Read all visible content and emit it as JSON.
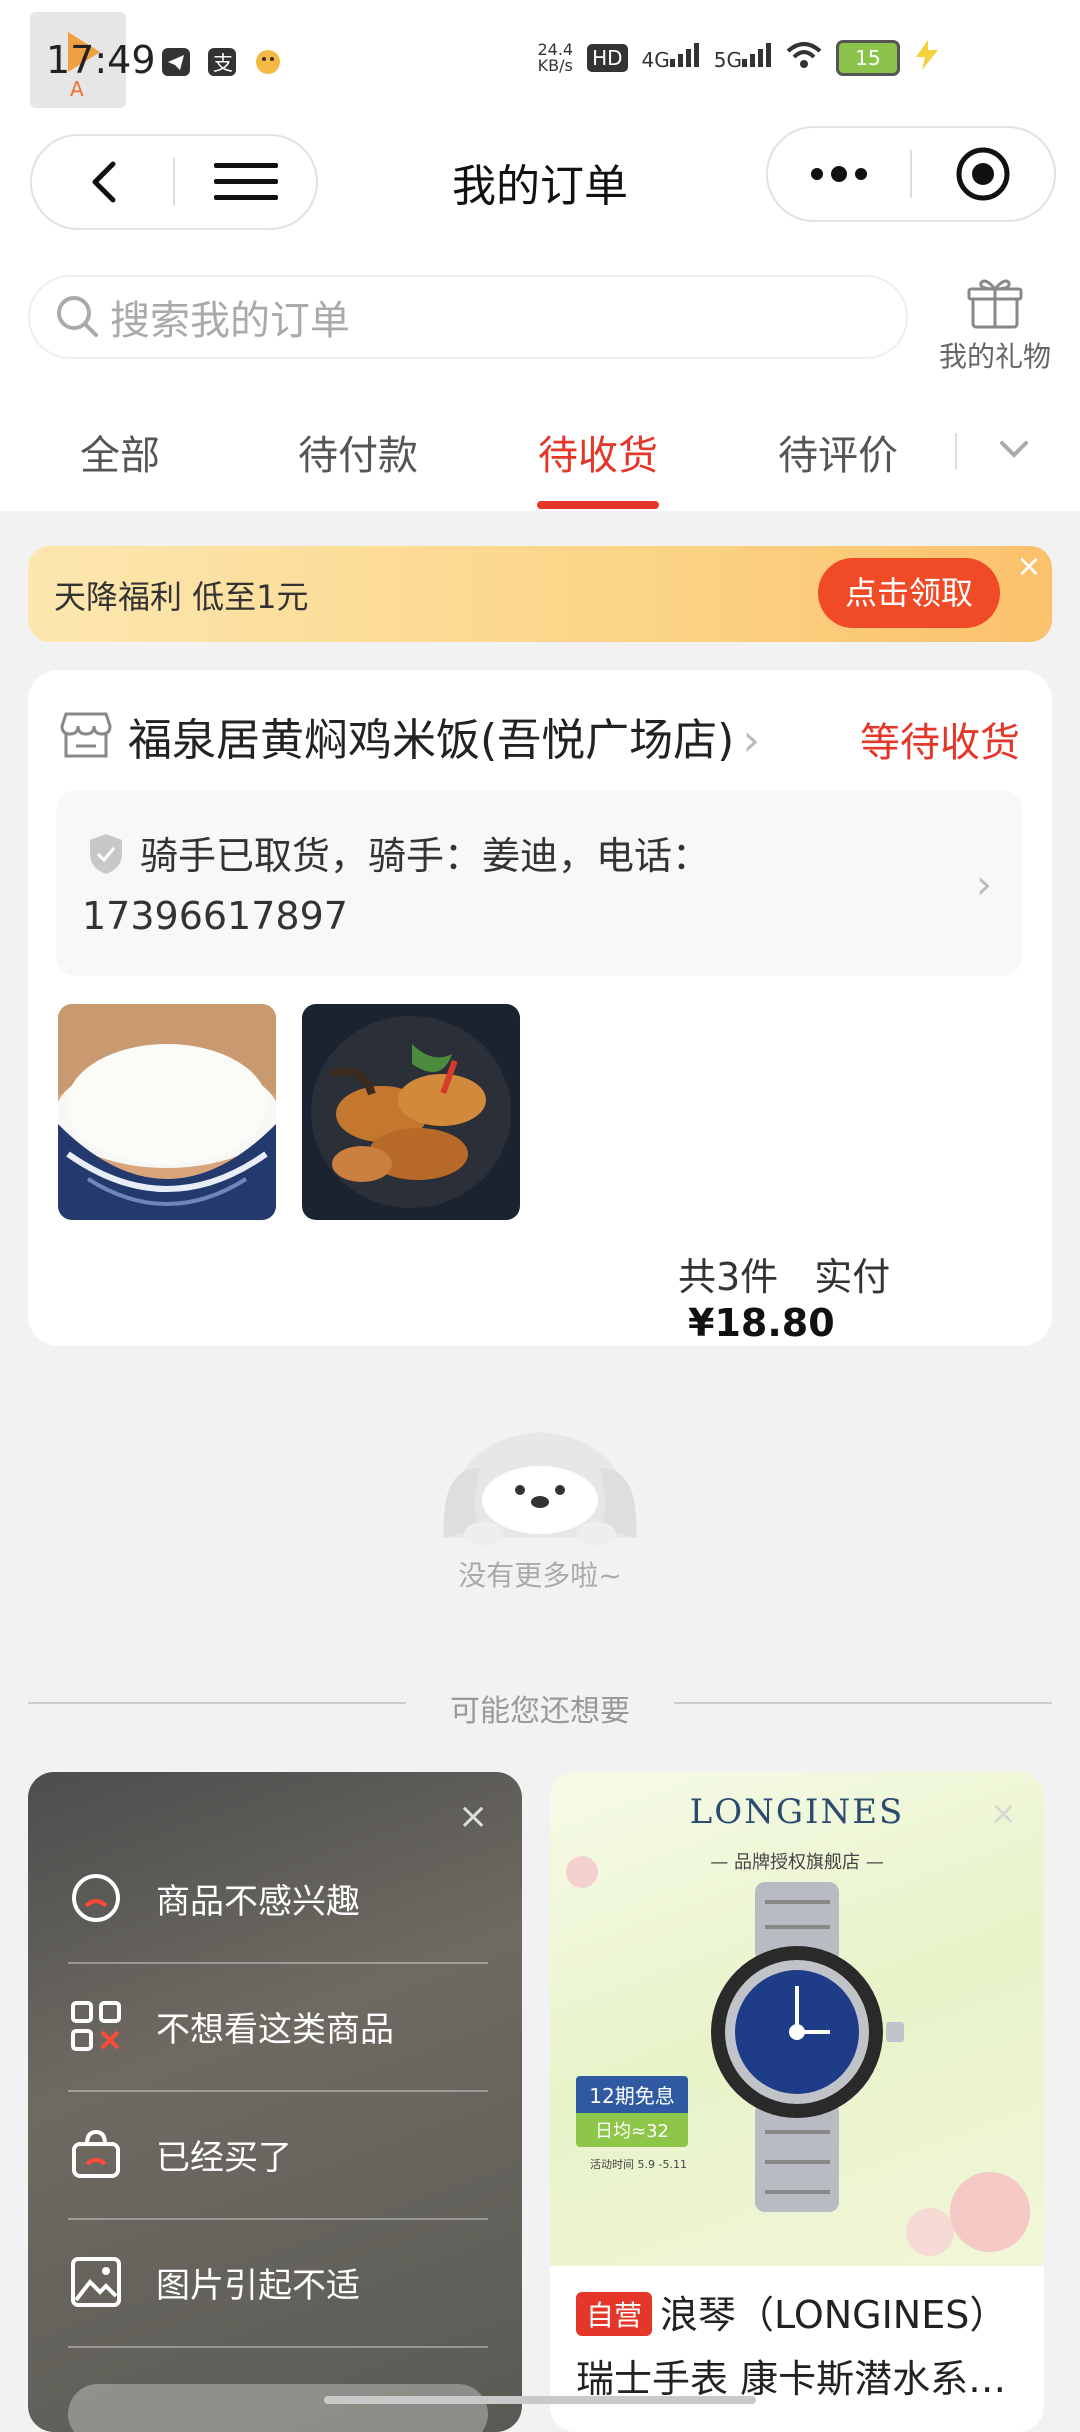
{
  "status_bar": {
    "time": "17:49",
    "net_speed": "24.4\nKB/s",
    "hd_label": "HD",
    "signal1": "4G",
    "signal2": "5G",
    "battery": "15"
  },
  "header": {
    "title": "我的订单"
  },
  "search": {
    "placeholder": "搜索我的订单",
    "gift_label": "我的礼物"
  },
  "tabs": [
    {
      "label": "全部"
    },
    {
      "label": "待付款"
    },
    {
      "label": "待收货"
    },
    {
      "label": "待评价"
    }
  ],
  "banner": {
    "text": "天降福利 低至1元",
    "button": "点击领取"
  },
  "order": {
    "shop_name": "福泉居黄焖鸡米饭(吾悦广场店)",
    "status": "等待收货",
    "rider_info": "骑手已取货，骑手：姜迪，电话：17396617897",
    "item_count": "共3件",
    "paid_label": "实付",
    "paid_amount": "¥18.80"
  },
  "empty": {
    "text": "没有更多啦~"
  },
  "recommend": {
    "title": "可能您还想要",
    "feedback_options": [
      {
        "label": "商品不感兴趣",
        "icon": "frown-circle-icon"
      },
      {
        "label": "不想看这类商品",
        "icon": "grid-x-icon"
      },
      {
        "label": "已经买了",
        "icon": "bag-icon"
      },
      {
        "label": "图片引起不适",
        "icon": "image-icon"
      }
    ],
    "product": {
      "brand": "LONGINES",
      "brand_sub": "— 品牌授权旗舰店 —",
      "promo_top": "12期免息",
      "promo_bottom": "日均≈32",
      "promo_date": "活动时间 5.9 -5.11",
      "tag": "自营",
      "name_line1": "浪琴（LONGINES）",
      "name_line2": "瑞士手表 康卡斯潜水系…"
    }
  },
  "colors": {
    "accent": "#e5362a",
    "banner_button": "#f04a26"
  }
}
